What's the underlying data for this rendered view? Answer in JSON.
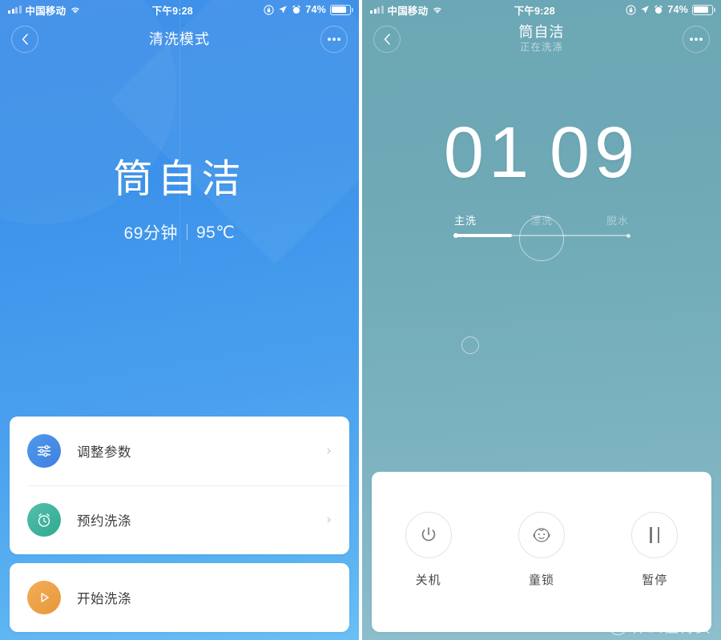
{
  "status_bar": {
    "carrier": "中国移动",
    "time": "下午9:28",
    "battery_percent": "74%",
    "icons": [
      "signal-bars-icon",
      "wifi-icon",
      "rotation-lock-icon",
      "location-arrow-icon",
      "alarm-clock-icon",
      "battery-icon"
    ]
  },
  "colors": {
    "left_bg_top": "#3f8fe8",
    "left_bg_bottom": "#69c0f5",
    "right_bg_top": "#6ca7b5",
    "right_bg_bottom": "#8dbfcd",
    "accent_blue": "#4a90e2",
    "accent_green": "#3fb8a0",
    "accent_orange": "#efa046",
    "card_bg": "#ffffff",
    "text_dark": "#3d3d3d"
  },
  "left_screen": {
    "nav": {
      "back_icon": "chevron-left-icon",
      "title": "清洗模式",
      "more_icon": "more-dots-icon"
    },
    "hero": {
      "program_name": "筒自洁",
      "duration": "69分钟",
      "temperature": "95℃"
    },
    "options": [
      {
        "label": "调整参数",
        "icon": "sliders-icon",
        "chevron": "›"
      },
      {
        "label": "预约洗涤",
        "icon": "alarm-clock-icon",
        "chevron": "›"
      }
    ],
    "primary_action": {
      "label": "开始洗涤",
      "icon": "play-icon"
    }
  },
  "right_screen": {
    "nav": {
      "back_icon": "chevron-left-icon",
      "title": "筒自洁",
      "subtitle": "正在洗涤",
      "more_icon": "more-dots-icon"
    },
    "timer": {
      "hours": "01",
      "minutes": "09"
    },
    "progress": {
      "steps": [
        "主洗",
        "漂洗",
        "脱水"
      ],
      "active_index": 0,
      "fill_percent": 33
    },
    "controls": [
      {
        "label": "关机",
        "icon": "power-icon"
      },
      {
        "label": "童锁",
        "icon": "baby-face-icon"
      },
      {
        "label": "暂停",
        "icon": "pause-icon"
      }
    ]
  },
  "watermark": {
    "badge": "值",
    "text": "什么值得买"
  }
}
